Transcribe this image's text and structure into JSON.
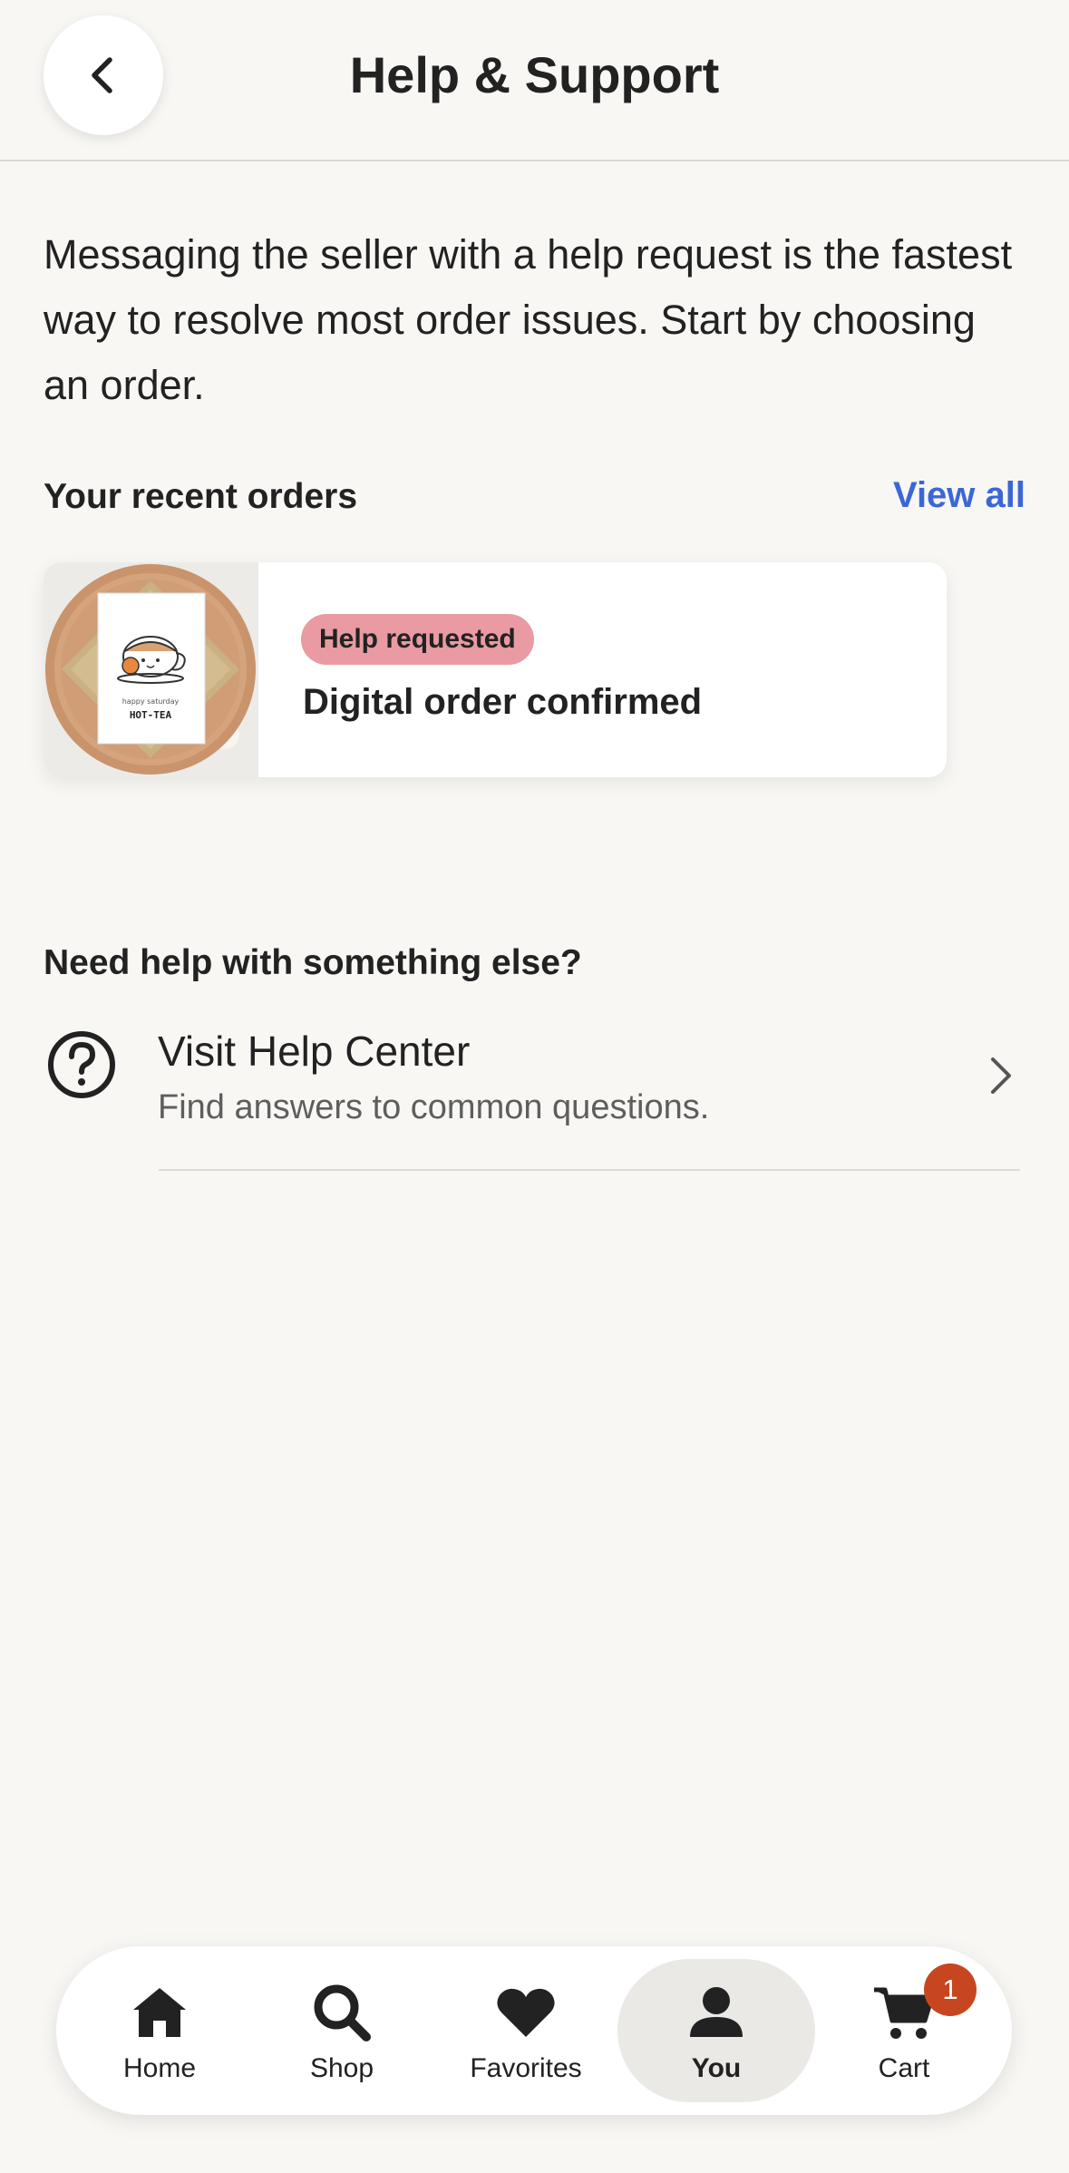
{
  "header": {
    "title": "Help & Support",
    "back_icon": "chevron-left-icon"
  },
  "intro_text": "Messaging the seller with a help request is the fastest way to resolve most order issues. Start by choosing an order.",
  "recent_orders": {
    "title": "Your recent orders",
    "view_all_label": "View all",
    "orders": [
      {
        "badge": "Help requested",
        "status": "Digital order confirmed",
        "thumbnail": "greeting-card-teacup-image",
        "thumbnail_text": "HOT-TEA"
      }
    ]
  },
  "help": {
    "title": "Need help with something else?",
    "items": [
      {
        "title": "Visit Help Center",
        "subtitle": "Find answers to common questions.",
        "icon": "question-circle-icon"
      }
    ]
  },
  "tabbar": {
    "items": [
      {
        "label": "Home",
        "icon": "home-icon",
        "active": false
      },
      {
        "label": "Shop",
        "icon": "search-icon",
        "active": false
      },
      {
        "label": "Favorites",
        "icon": "heart-icon",
        "active": false
      },
      {
        "label": "You",
        "icon": "person-icon",
        "active": true
      },
      {
        "label": "Cart",
        "icon": "cart-icon",
        "active": false,
        "badge": "1"
      }
    ]
  },
  "colors": {
    "background": "#f8f7f4",
    "link": "#3b67d6",
    "badge_bg": "#e99aa3",
    "cart_badge": "#c7461f",
    "active_tab_bg": "#eae9e5"
  }
}
